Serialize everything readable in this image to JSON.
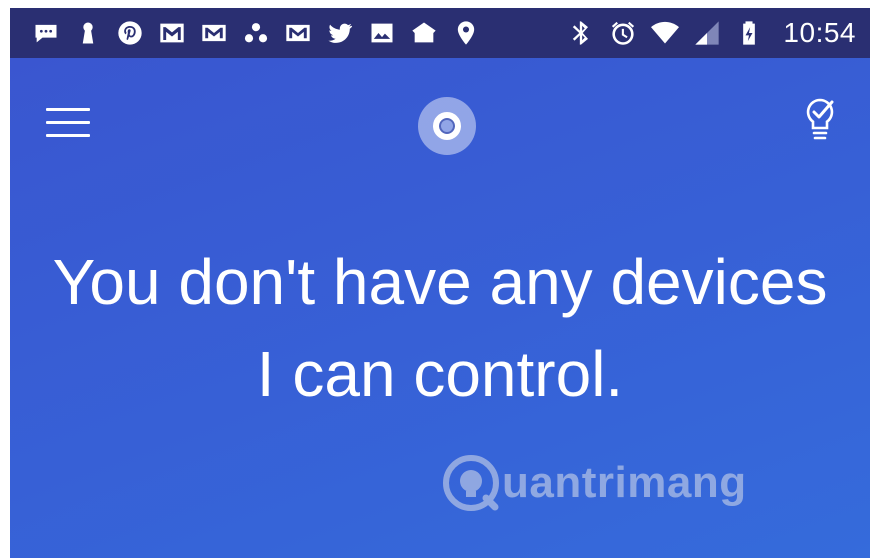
{
  "status_bar": {
    "time": "10:54",
    "icons": [
      "messages-icon",
      "keyhole-icon",
      "pinterest-icon",
      "gmail-icon",
      "gmail-icon",
      "dots-icon",
      "gmail-icon",
      "twitter-icon",
      "photo-icon",
      "home-icon",
      "location-icon",
      "bluetooth-icon",
      "alarm-icon",
      "wifi-icon",
      "signal-icon",
      "battery-charging-icon"
    ]
  },
  "app_bar": {
    "menu_icon": "hamburger-menu-icon",
    "center_icon": "cortana-icon",
    "right_icon": "lightbulb-check-icon"
  },
  "message": {
    "line1": "You don't have any devices",
    "line2": "I can control."
  },
  "watermark": {
    "text": "uantrimang"
  },
  "colors": {
    "background": "#3a5cd2",
    "status_bar": "#2a2f72",
    "text": "#ffffff"
  }
}
